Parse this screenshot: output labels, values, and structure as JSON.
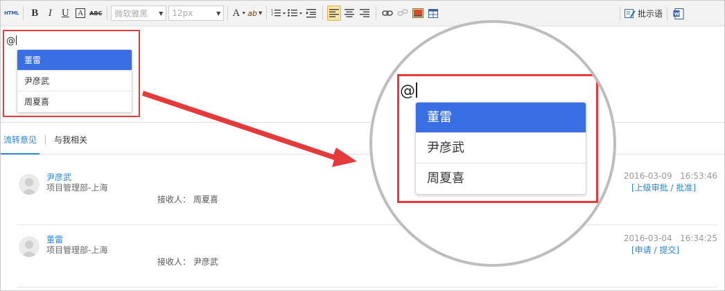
{
  "toolbar": {
    "html_label": "HTML",
    "bold_label": "B",
    "italic_label": "I",
    "underline_label": "U",
    "fontcolor_box_label": "A",
    "strike_label": "ABC",
    "font_family_value": "微软雅黑",
    "font_size_value": "12px",
    "font_color_label": "A",
    "highlight_label": "ab",
    "comment_label": "批示语"
  },
  "editor": {
    "mention_text": "@",
    "mention_options": [
      "董雷",
      "尹彦武",
      "周夏喜"
    ],
    "selected_option": "董雷"
  },
  "tabs": [
    {
      "label": "流转意见",
      "active": true
    },
    {
      "label": "与我相关",
      "active": false
    }
  ],
  "records": [
    {
      "name": "尹彦武",
      "dept": "项目管理部-上海",
      "receiver_label": "接收人：",
      "receiver": "周夏喜",
      "date": "2016-03-09",
      "time": "16:53:46",
      "action": "[上级审批 / 批准]"
    },
    {
      "name": "董雷",
      "dept": "项目管理部-上海",
      "receiver_label": "接收人：",
      "receiver": "尹彦武",
      "date": "2016-03-04",
      "time": "16:34:25",
      "action": "[申请 / 提交]"
    }
  ],
  "colors": {
    "accent": "#2a84d0",
    "selected": "#3a6fe4",
    "highlight_red": "#e53a3a"
  }
}
